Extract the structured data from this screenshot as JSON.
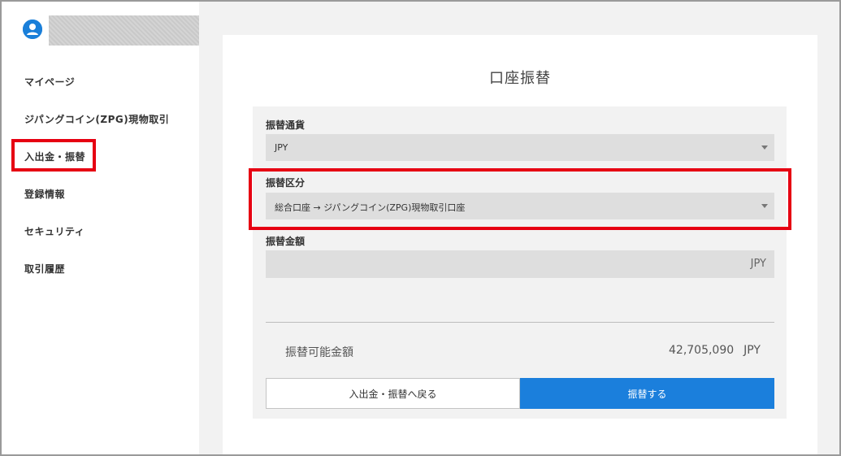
{
  "sidebar": {
    "items": [
      {
        "label": "マイページ"
      },
      {
        "label": "ジパングコイン(ZPG)現物取引"
      },
      {
        "label": "入出金・振替"
      },
      {
        "label": "登録情報"
      },
      {
        "label": "セキュリティ"
      },
      {
        "label": "取引履歴"
      }
    ],
    "highlighted_index": 2,
    "avatar_icon": "user-avatar-icon"
  },
  "main": {
    "title": "口座振替",
    "fields": {
      "currency": {
        "label": "振替通貨",
        "value": "JPY"
      },
      "category": {
        "label": "振替区分",
        "value": "総合口座 → ジパングコイン(ZPG)現物取引口座"
      },
      "amount": {
        "label": "振替金額",
        "value": "",
        "unit": "JPY"
      }
    },
    "available": {
      "label": "振替可能金額",
      "value": "42,705,090",
      "currency": "JPY"
    },
    "buttons": {
      "back": "入出金・振替へ戻る",
      "submit": "振替する"
    }
  },
  "colors": {
    "accent": "#1b7fdc",
    "highlight_border": "#e60012",
    "panel_bg": "#f2f2f2",
    "input_bg": "#dedede"
  }
}
